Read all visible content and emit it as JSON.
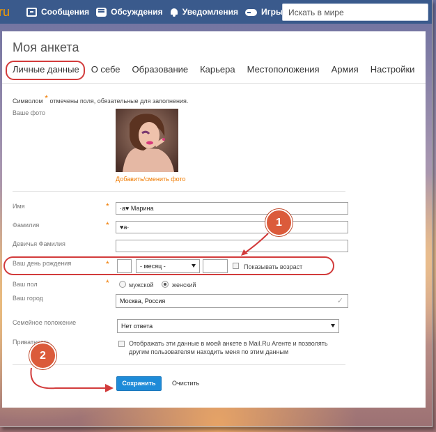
{
  "topbar": {
    "logo": "ru",
    "nav": [
      {
        "label": "Сообщения",
        "icon": "messages-icon"
      },
      {
        "label": "Обсуждения",
        "icon": "discussions-icon"
      },
      {
        "label": "Уведомления",
        "icon": "bell-icon"
      },
      {
        "label": "Игры",
        "icon": "gamepad-icon"
      }
    ],
    "search_placeholder": "Искать в мире"
  },
  "profile": {
    "title": "Моя анкета",
    "tabs": [
      "Личные данные",
      "О себе",
      "Образование",
      "Карьера",
      "Местоположения",
      "Армия",
      "Настройки"
    ],
    "active_tab": "Личные данные",
    "hint_prefix": "Символом",
    "hint_star": "*",
    "hint_suffix": "отмечены поля, обязательные для заполнения."
  },
  "form": {
    "photo_label": "Ваше фото",
    "photo_link": "Добавить/сменить фото",
    "first_name_label": "Имя",
    "first_name_value": "·a♥ Марина",
    "last_name_label": "Фамилия",
    "last_name_value": "♥a·",
    "maiden_name_label": "Девичья Фамилия",
    "maiden_name_value": "",
    "birthday_label": "Ваш день рождения",
    "birthday_day": "",
    "birthday_month": "- месяц -",
    "birthday_year": "",
    "show_age_label": "Показывать возраст",
    "gender_label": "Ваш пол",
    "gender_male": "мужской",
    "gender_female": "женский",
    "gender_selected": "женский",
    "city_label": "Ваш город",
    "city_value": "Москва, Россия",
    "marital_label": "Семейное положение",
    "marital_value": "Нет ответа",
    "privacy_label": "Приватность",
    "privacy_text_line1": "Отображать эти данные в моей анкете в Mail.Ru Агенте и позволять",
    "privacy_text_line2": "другим пользователям находить меня по этим данным",
    "save_button": "Сохранить",
    "clear_button": "Очистить",
    "required_star": "*"
  },
  "annotations": {
    "badge1": "1",
    "badge2": "2",
    "color": "#d23b3b"
  }
}
